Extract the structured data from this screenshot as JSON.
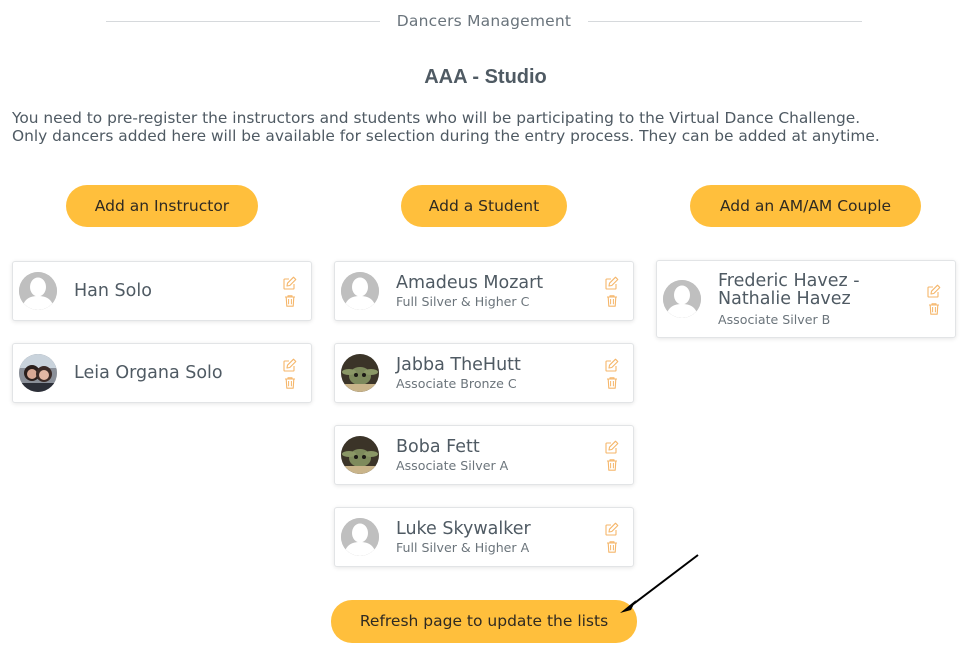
{
  "header": {
    "title": "Dancers Management"
  },
  "studio": {
    "title": "AAA - Studio"
  },
  "intro": {
    "line1": "You need to pre-register the instructors and students who will be participating to the Virtual Dance Challenge.",
    "line2": "Only dancers added here will be available for selection during the entry process. They can be added at anytime."
  },
  "buttons": {
    "add_instructor": "Add an Instructor",
    "add_student": "Add a Student",
    "add_couple": "Add an AM/AM Couple",
    "refresh": "Refresh page to update the lists"
  },
  "instructors": [
    {
      "name": "Han Solo",
      "avatar": "default-avatar"
    },
    {
      "name": "Leia Organa Solo",
      "avatar": "photo-avatar"
    }
  ],
  "students": [
    {
      "name": "Amadeus Mozart",
      "level": "Full Silver & Higher C",
      "avatar": "default-avatar"
    },
    {
      "name": "Jabba TheHutt",
      "level": "Associate Bronze C",
      "avatar": "photo-avatar"
    },
    {
      "name": "Boba Fett",
      "level": "Associate Silver A",
      "avatar": "photo-avatar"
    },
    {
      "name": "Luke Skywalker",
      "level": "Full Silver & Higher A",
      "avatar": "default-avatar"
    }
  ],
  "couples": [
    {
      "name_line1": "Frederic Havez -",
      "name_line2": "Nathalie Havez",
      "level": "Associate Silver B",
      "avatar": "default-avatar"
    }
  ],
  "colors": {
    "accent": "#ffbf3c",
    "action_icon": "#f5b66a",
    "text": "#4f5a63",
    "border": "#e2e4e6"
  }
}
